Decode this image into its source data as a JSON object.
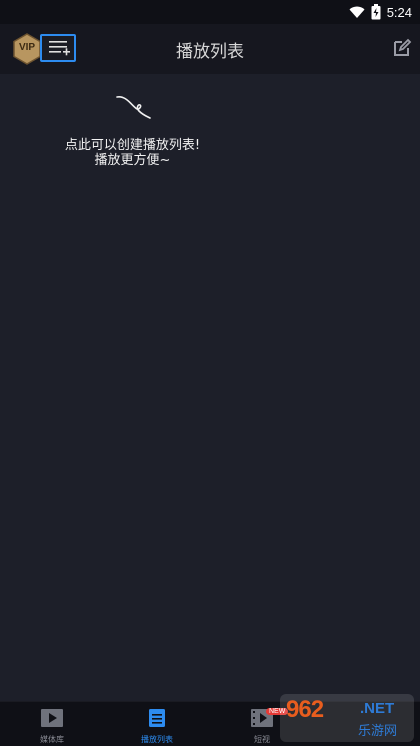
{
  "status_bar": {
    "time": "5:24",
    "icons": [
      "wifi-icon",
      "battery-charging-icon"
    ]
  },
  "app_bar": {
    "vip_label": "VIP",
    "title": "播放列表",
    "left_icon": "add-playlist-icon",
    "right_icon": "edit-icon",
    "accent_color": "#2d8cf0"
  },
  "empty_state": {
    "hint_line1": "点此可以创建播放列表!",
    "hint_line2": "播放更方便~"
  },
  "bottom_nav": {
    "items": [
      {
        "label": "媒体库",
        "icon": "play-folder-icon",
        "active": false
      },
      {
        "label": "播放列表",
        "icon": "list-document-icon",
        "active": true
      },
      {
        "label": "短视",
        "icon": "film-icon",
        "active": false,
        "badge": "NEW"
      }
    ]
  },
  "watermark": {
    "logo": "962",
    "domain": ".NET",
    "subtitle": "乐游网"
  }
}
